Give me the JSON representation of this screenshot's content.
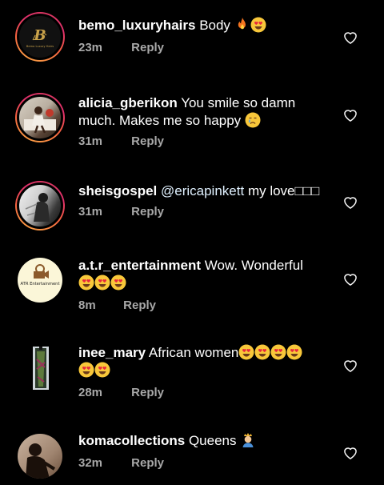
{
  "comments": [
    {
      "user": "bemo_luxuryhairs",
      "text": "Body",
      "time": "23m",
      "reply": "Reply",
      "emojis": [
        "fire",
        "heart-eyes"
      ],
      "logo_text": "Bemo Luxury Hairs"
    },
    {
      "user": "alicia_gberikon",
      "text_line1": "You smile so damn",
      "text_line2": "much. Makes me so happy",
      "time": "31m",
      "reply": "Reply",
      "emojis": [
        "crying-face"
      ]
    },
    {
      "user": "sheisgospel",
      "mention": "@ericapinkett",
      "text": "my love",
      "time": "31m",
      "reply": "Reply",
      "glyphs": "□□□"
    },
    {
      "user": "a.t.r_entertainment",
      "text": "Wow. Wonderful",
      "time": "8m",
      "reply": "Reply",
      "emojis": [
        "heart-eyes",
        "heart-eyes",
        "heart-eyes"
      ],
      "logo_text": "ATR Entertainment"
    },
    {
      "user": "inee_mary",
      "text": "African women",
      "time": "28m",
      "reply": "Reply",
      "emojis": [
        "heart-eyes",
        "heart-eyes",
        "heart-eyes",
        "heart-eyes",
        "heart-eyes",
        "heart-eyes"
      ]
    },
    {
      "user": "komacollections",
      "text": "Queens",
      "time": "32m",
      "reply": "Reply",
      "emojis": [
        "queen-emoji"
      ]
    }
  ],
  "colors": {
    "background": "#000000",
    "meta": "#a8a8a8",
    "mention": "#e0f1ff",
    "ring_start": "#e1306c",
    "ring_end": "#fcaf45"
  }
}
